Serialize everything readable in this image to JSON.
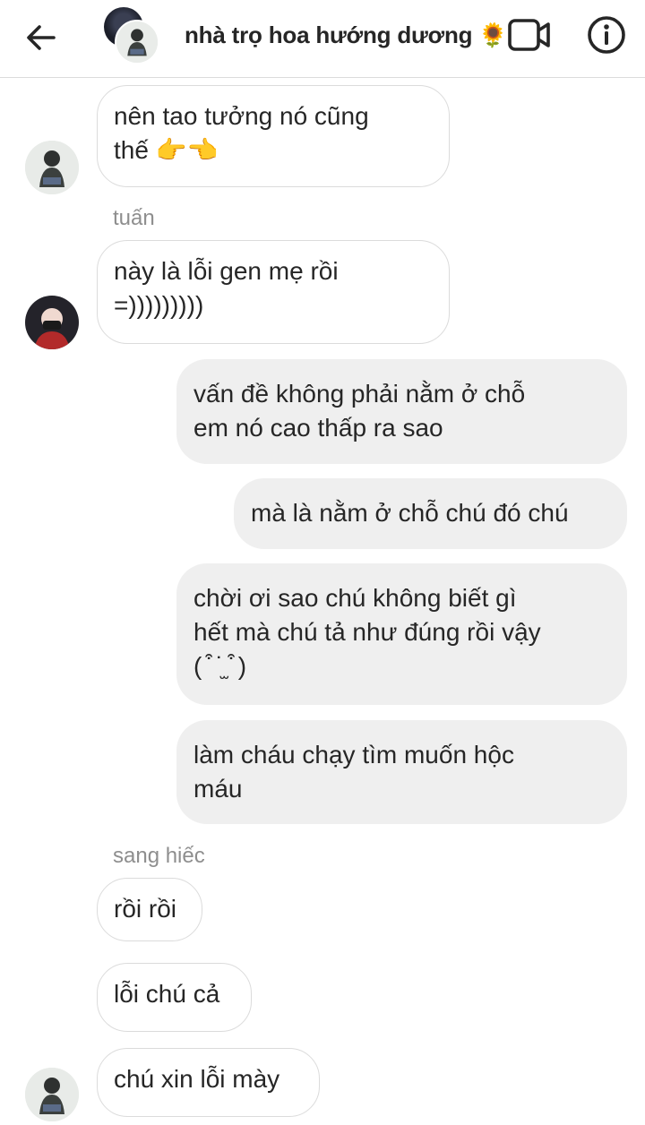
{
  "header": {
    "title": "nhà trọ hoa hướng dương 🌻",
    "back_icon": "back-arrow-icon",
    "video_icon": "video-call-icon",
    "info_icon": "info-icon"
  },
  "messages": {
    "m1": {
      "line1": "nên tao tưởng nó cũng",
      "line2": "thế 👉👈"
    },
    "sender_tuan": "tuấn",
    "m2": {
      "line1": "này là lỗi gen mẹ rồi",
      "line2": "=)))))))))"
    },
    "m3": {
      "line1": "vấn đề không phải nằm ở chỗ",
      "line2": "em nó cao thấp ra sao"
    },
    "m4": {
      "line1": "mà là nằm ở chỗ chú đó chú"
    },
    "m5": {
      "line1": "chời ơi sao chú không biết gì",
      "line2": "hết mà chú tả như đúng rồi vậy",
      "line3": "( ͒ ˙̫ ͒ )"
    },
    "m6": {
      "line1": "làm cháu chạy tìm muốn hộc",
      "line2": "máu"
    },
    "sender_sang": "sang hiếc",
    "m7": "rồi rồi",
    "m8": "lỗi chú cả",
    "m9": "chú xin lỗi mày"
  },
  "colors": {
    "outgoing_bubble": "#efefef",
    "incoming_border": "#dbdbdb",
    "sender_label": "#8e8e8e"
  }
}
